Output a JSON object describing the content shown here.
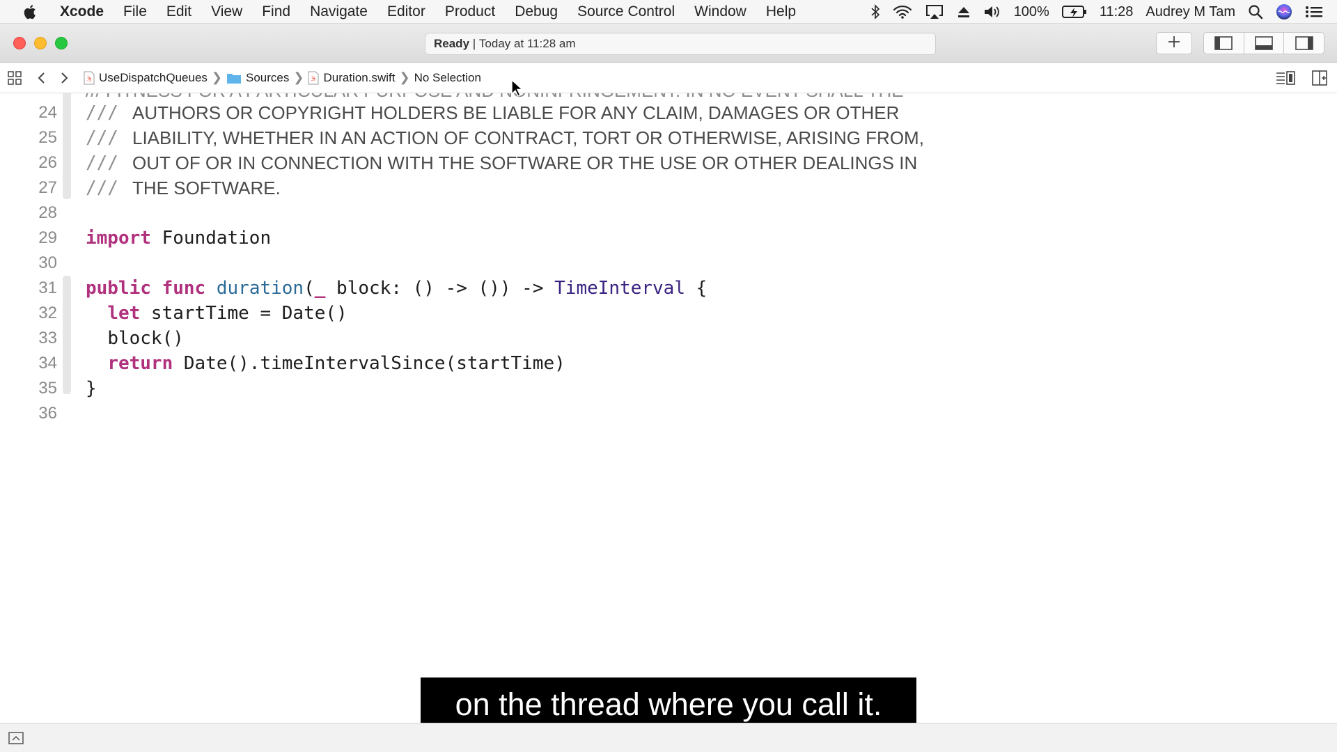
{
  "menubar": {
    "app_name": "Xcode",
    "items": [
      "File",
      "Edit",
      "View",
      "Find",
      "Navigate",
      "Editor",
      "Product",
      "Debug",
      "Source Control",
      "Window",
      "Help"
    ],
    "battery": "100%",
    "time": "11:28",
    "user": "Audrey M Tam"
  },
  "toolbar": {
    "status_bold": "Ready",
    "status_sep": " | ",
    "status_time": "Today at 11:28 am"
  },
  "jumpbar": {
    "project": "UseDispatchQueues",
    "folder": "Sources",
    "file": "Duration.swift",
    "selection": "No Selection"
  },
  "editor": {
    "partial_line": "/// FITNESS FOR A PARTICULAR PURPOSE AND NONINFRINGEMENT. IN NO EVENT SHALL THE",
    "lines": [
      {
        "num": "24",
        "slashes": "///",
        "text": "AUTHORS OR COPYRIGHT HOLDERS BE LIABLE FOR ANY CLAIM, DAMAGES OR OTHER"
      },
      {
        "num": "25",
        "slashes": "///",
        "text": "LIABILITY, WHETHER IN AN ACTION OF CONTRACT, TORT OR OTHERWISE, ARISING FROM,"
      },
      {
        "num": "26",
        "slashes": "///",
        "text": "OUT OF OR IN CONNECTION WITH THE SOFTWARE OR THE USE OR OTHER DEALINGS IN"
      },
      {
        "num": "27",
        "slashes": "///",
        "text": "THE SOFTWARE."
      },
      {
        "num": "28"
      },
      {
        "num": "29",
        "kw1": "import",
        "rest": " Foundation"
      },
      {
        "num": "30"
      },
      {
        "num": "31",
        "kw1": "public",
        "kw2": "func",
        "fn": "duration",
        "p1": "(",
        "kw3": "_",
        "p2": " block: () -> ()) -> ",
        "ty": "TimeInterval",
        "p3": " {"
      },
      {
        "num": "32",
        "indent": "  ",
        "kw1": "let",
        "rest": " startTime = Date()"
      },
      {
        "num": "33",
        "indent": "  ",
        "rest": "block()"
      },
      {
        "num": "34",
        "indent": "  ",
        "kw1": "return",
        "rest": " Date().timeIntervalSince(startTime)"
      },
      {
        "num": "35",
        "rest": "}"
      },
      {
        "num": "36"
      }
    ]
  },
  "subtitle": "on the thread where you call it.",
  "colors": {
    "keyword": "#b0317d",
    "function": "#2b6a98",
    "type": "#3a2380",
    "comment": "#8f8f8f"
  }
}
